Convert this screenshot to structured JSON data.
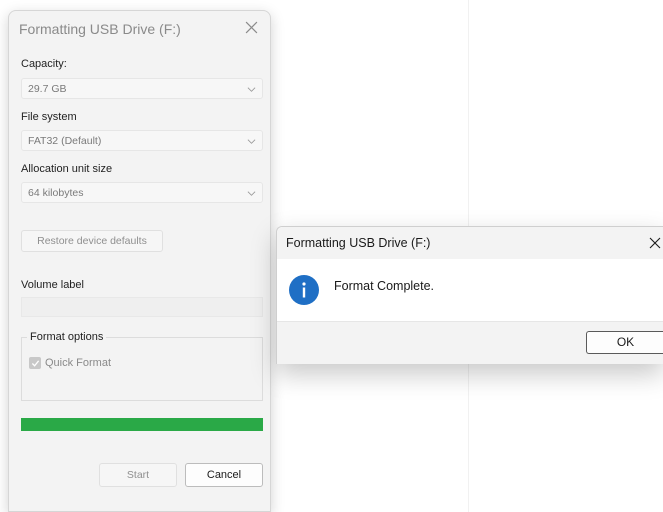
{
  "format_window": {
    "title": "Formatting USB Drive (F:)",
    "capacity": {
      "label": "Capacity:",
      "value": "29.7 GB"
    },
    "file_system": {
      "label": "File system",
      "value": "FAT32 (Default)"
    },
    "allocation": {
      "label": "Allocation unit size",
      "value": "64 kilobytes"
    },
    "restore_label": "Restore device defaults",
    "volume_label": {
      "label": "Volume label",
      "value": ""
    },
    "format_options": {
      "legend": "Format options",
      "quick_format": {
        "label": "Quick Format",
        "checked": true
      }
    },
    "progress_percent": 100,
    "progress_color": "#2aa947",
    "start_label": "Start",
    "cancel_label": "Cancel"
  },
  "message_box": {
    "title": "Formatting USB Drive (F:)",
    "icon": "info-icon",
    "message": "Format Complete.",
    "ok_label": "OK",
    "icon_color": "#1f6fc5"
  }
}
